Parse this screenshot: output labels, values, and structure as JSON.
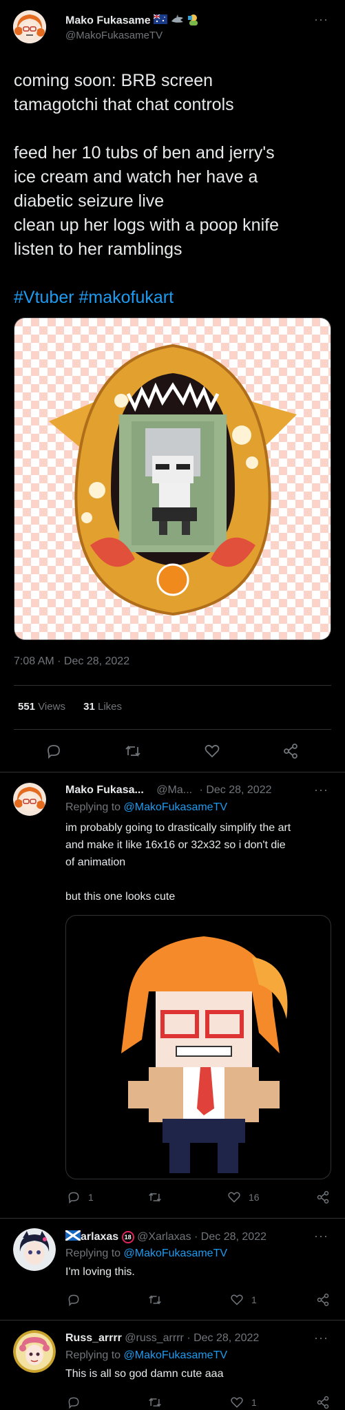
{
  "main_tweet": {
    "author_name": "Mako Fukasame",
    "author_handle": "@MakoFukasameTV",
    "text_lines": [
      "coming soon: BRB screen",
      "tamagotchi that chat controls",
      "",
      "feed her 10 tubs of ben and jerry's",
      "ice cream and watch her have a",
      "diabetic seizure live",
      "clean up her logs with a poop knife",
      "listen to her ramblings"
    ],
    "hashtags": [
      "#Vtuber",
      "#makofukart"
    ],
    "timestamp": "7:08 AM · Dec 28, 2022",
    "views_count": "551",
    "views_label": "Views",
    "likes_count": "31",
    "likes_label": "Likes"
  },
  "replies": [
    {
      "author_name": "Mako Fukasa...",
      "author_handle": "@Ma...",
      "date": "· Dec 28, 2022",
      "replying_prefix": "Replying to",
      "replying_to": "@MakoFukasameTV",
      "text_lines": [
        "im probably going to drastically simplify the art",
        "and make it like 16x16 or 32x32 so i don't die",
        "of animation",
        "",
        "but this one looks cute"
      ],
      "reply_count": "1",
      "like_count": "16"
    },
    {
      "author_name": "arlaxas",
      "author_badge": "18",
      "author_handle": "@Xarlaxas",
      "date": "· Dec 28, 2022",
      "replying_prefix": "Replying to",
      "replying_to": "@MakoFukasameTV",
      "text": "I'm loving this.",
      "like_count": "1"
    },
    {
      "author_name": "Russ_arrrr",
      "author_handle": "@russ_arrrr",
      "date": "· Dec 28, 2022",
      "replying_prefix": "Replying to",
      "replying_to": "@MakoFukasameTV",
      "text": "This is all so god damn cute aaa",
      "like_count": "1"
    }
  ],
  "colors": {
    "background": "#000000",
    "text": "#e7e9ea",
    "muted": "#71767b",
    "link": "#1d9bf0",
    "divider": "#2f3336"
  }
}
